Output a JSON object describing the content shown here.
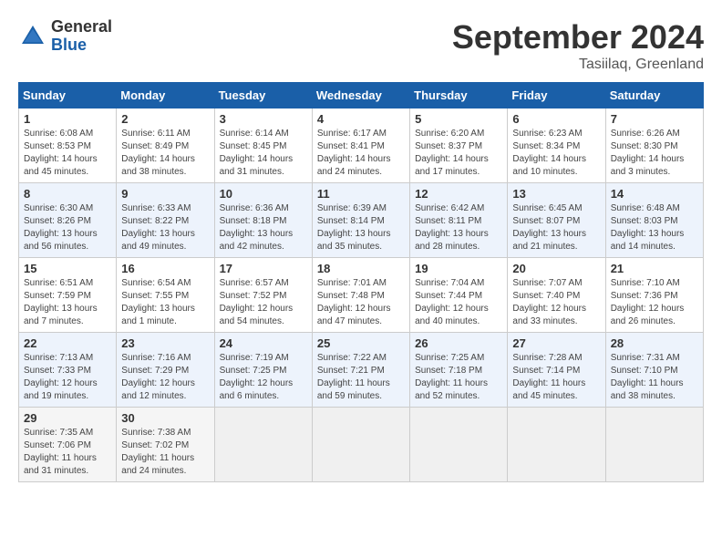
{
  "header": {
    "logo_general": "General",
    "logo_blue": "Blue",
    "month_title": "September 2024",
    "location": "Tasiilaq, Greenland"
  },
  "calendar": {
    "days_of_week": [
      "Sunday",
      "Monday",
      "Tuesday",
      "Wednesday",
      "Thursday",
      "Friday",
      "Saturday"
    ],
    "weeks": [
      [
        null,
        null,
        null,
        null,
        null,
        null,
        null
      ]
    ],
    "cells": [
      {
        "day": null
      },
      {
        "day": null
      },
      {
        "day": null
      },
      {
        "day": null
      },
      {
        "day": null
      },
      {
        "day": null
      },
      {
        "day": null
      }
    ]
  },
  "weeks": [
    [
      {
        "num": "1",
        "lines": [
          "Sunrise: 6:08 AM",
          "Sunset: 8:53 PM",
          "Daylight: 14 hours",
          "and 45 minutes."
        ]
      },
      {
        "num": "2",
        "lines": [
          "Sunrise: 6:11 AM",
          "Sunset: 8:49 PM",
          "Daylight: 14 hours",
          "and 38 minutes."
        ]
      },
      {
        "num": "3",
        "lines": [
          "Sunrise: 6:14 AM",
          "Sunset: 8:45 PM",
          "Daylight: 14 hours",
          "and 31 minutes."
        ]
      },
      {
        "num": "4",
        "lines": [
          "Sunrise: 6:17 AM",
          "Sunset: 8:41 PM",
          "Daylight: 14 hours",
          "and 24 minutes."
        ]
      },
      {
        "num": "5",
        "lines": [
          "Sunrise: 6:20 AM",
          "Sunset: 8:37 PM",
          "Daylight: 14 hours",
          "and 17 minutes."
        ]
      },
      {
        "num": "6",
        "lines": [
          "Sunrise: 6:23 AM",
          "Sunset: 8:34 PM",
          "Daylight: 14 hours",
          "and 10 minutes."
        ]
      },
      {
        "num": "7",
        "lines": [
          "Sunrise: 6:26 AM",
          "Sunset: 8:30 PM",
          "Daylight: 14 hours",
          "and 3 minutes."
        ]
      }
    ],
    [
      {
        "num": "8",
        "lines": [
          "Sunrise: 6:30 AM",
          "Sunset: 8:26 PM",
          "Daylight: 13 hours",
          "and 56 minutes."
        ]
      },
      {
        "num": "9",
        "lines": [
          "Sunrise: 6:33 AM",
          "Sunset: 8:22 PM",
          "Daylight: 13 hours",
          "and 49 minutes."
        ]
      },
      {
        "num": "10",
        "lines": [
          "Sunrise: 6:36 AM",
          "Sunset: 8:18 PM",
          "Daylight: 13 hours",
          "and 42 minutes."
        ]
      },
      {
        "num": "11",
        "lines": [
          "Sunrise: 6:39 AM",
          "Sunset: 8:14 PM",
          "Daylight: 13 hours",
          "and 35 minutes."
        ]
      },
      {
        "num": "12",
        "lines": [
          "Sunrise: 6:42 AM",
          "Sunset: 8:11 PM",
          "Daylight: 13 hours",
          "and 28 minutes."
        ]
      },
      {
        "num": "13",
        "lines": [
          "Sunrise: 6:45 AM",
          "Sunset: 8:07 PM",
          "Daylight: 13 hours",
          "and 21 minutes."
        ]
      },
      {
        "num": "14",
        "lines": [
          "Sunrise: 6:48 AM",
          "Sunset: 8:03 PM",
          "Daylight: 13 hours",
          "and 14 minutes."
        ]
      }
    ],
    [
      {
        "num": "15",
        "lines": [
          "Sunrise: 6:51 AM",
          "Sunset: 7:59 PM",
          "Daylight: 13 hours",
          "and 7 minutes."
        ]
      },
      {
        "num": "16",
        "lines": [
          "Sunrise: 6:54 AM",
          "Sunset: 7:55 PM",
          "Daylight: 13 hours",
          "and 1 minute."
        ]
      },
      {
        "num": "17",
        "lines": [
          "Sunrise: 6:57 AM",
          "Sunset: 7:52 PM",
          "Daylight: 12 hours",
          "and 54 minutes."
        ]
      },
      {
        "num": "18",
        "lines": [
          "Sunrise: 7:01 AM",
          "Sunset: 7:48 PM",
          "Daylight: 12 hours",
          "and 47 minutes."
        ]
      },
      {
        "num": "19",
        "lines": [
          "Sunrise: 7:04 AM",
          "Sunset: 7:44 PM",
          "Daylight: 12 hours",
          "and 40 minutes."
        ]
      },
      {
        "num": "20",
        "lines": [
          "Sunrise: 7:07 AM",
          "Sunset: 7:40 PM",
          "Daylight: 12 hours",
          "and 33 minutes."
        ]
      },
      {
        "num": "21",
        "lines": [
          "Sunrise: 7:10 AM",
          "Sunset: 7:36 PM",
          "Daylight: 12 hours",
          "and 26 minutes."
        ]
      }
    ],
    [
      {
        "num": "22",
        "lines": [
          "Sunrise: 7:13 AM",
          "Sunset: 7:33 PM",
          "Daylight: 12 hours",
          "and 19 minutes."
        ]
      },
      {
        "num": "23",
        "lines": [
          "Sunrise: 7:16 AM",
          "Sunset: 7:29 PM",
          "Daylight: 12 hours",
          "and 12 minutes."
        ]
      },
      {
        "num": "24",
        "lines": [
          "Sunrise: 7:19 AM",
          "Sunset: 7:25 PM",
          "Daylight: 12 hours",
          "and 6 minutes."
        ]
      },
      {
        "num": "25",
        "lines": [
          "Sunrise: 7:22 AM",
          "Sunset: 7:21 PM",
          "Daylight: 11 hours",
          "and 59 minutes."
        ]
      },
      {
        "num": "26",
        "lines": [
          "Sunrise: 7:25 AM",
          "Sunset: 7:18 PM",
          "Daylight: 11 hours",
          "and 52 minutes."
        ]
      },
      {
        "num": "27",
        "lines": [
          "Sunrise: 7:28 AM",
          "Sunset: 7:14 PM",
          "Daylight: 11 hours",
          "and 45 minutes."
        ]
      },
      {
        "num": "28",
        "lines": [
          "Sunrise: 7:31 AM",
          "Sunset: 7:10 PM",
          "Daylight: 11 hours",
          "and 38 minutes."
        ]
      }
    ],
    [
      {
        "num": "29",
        "lines": [
          "Sunrise: 7:35 AM",
          "Sunset: 7:06 PM",
          "Daylight: 11 hours",
          "and 31 minutes."
        ]
      },
      {
        "num": "30",
        "lines": [
          "Sunrise: 7:38 AM",
          "Sunset: 7:02 PM",
          "Daylight: 11 hours",
          "and 24 minutes."
        ]
      },
      null,
      null,
      null,
      null,
      null
    ]
  ]
}
